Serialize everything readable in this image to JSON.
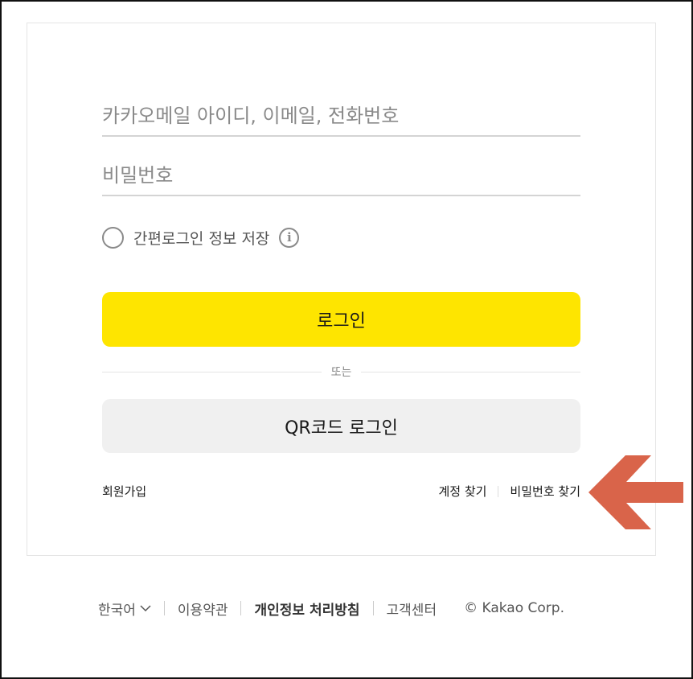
{
  "login_form": {
    "id_placeholder": "카카오메일 아이디, 이메일, 전화번호",
    "password_placeholder": "비밀번호",
    "save_login_label": "간편로그인 정보 저장",
    "login_button": "로그인",
    "divider_text": "또는",
    "qr_login_button": "QR코드 로그인",
    "signup_link": "회원가입",
    "find_account_link": "계정 찾기",
    "find_password_link": "비밀번호 찾기"
  },
  "annotation": {
    "arrow_color": "#d9644a",
    "icon": "left-arrow-icon"
  },
  "footer": {
    "language": "한국어",
    "terms": "이용약관",
    "privacy": "개인정보 처리방침",
    "support": "고객센터",
    "copyright": "© Kakao Corp."
  },
  "colors": {
    "login_button": "#fee500",
    "qr_button": "#f0f0f0"
  }
}
